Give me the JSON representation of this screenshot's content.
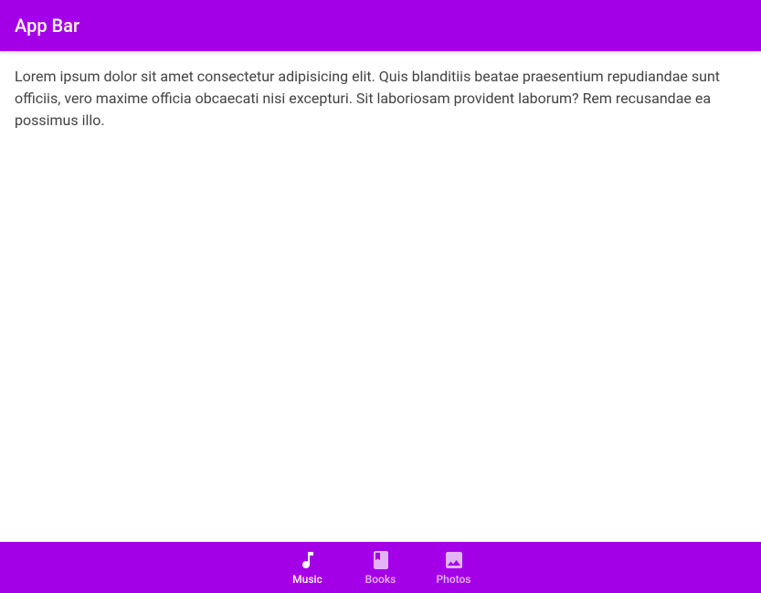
{
  "header": {
    "title": "App Bar"
  },
  "content": {
    "body": "Lorem ipsum dolor sit amet consectetur adipisicing elit. Quis blanditiis beatae praesentium repudiandae sunt officiis, vero maxime officia obcaecati nisi excepturi. Sit laboriosam provident laborum? Rem recusandae ea possimus illo."
  },
  "bottomNav": {
    "items": [
      {
        "label": "Music",
        "icon": "music-note-icon",
        "active": true
      },
      {
        "label": "Books",
        "icon": "book-icon",
        "active": false
      },
      {
        "label": "Photos",
        "icon": "image-icon",
        "active": false
      }
    ]
  },
  "colors": {
    "primary": "#a400e8"
  }
}
